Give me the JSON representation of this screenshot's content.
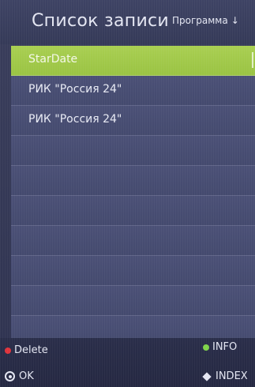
{
  "header": {
    "title": "Список записи",
    "sort_label": "Программа",
    "sort_arrow": "↓"
  },
  "recordings": [
    {
      "label": "StarDate",
      "selected": true
    },
    {
      "label": "РИК \"Россия 24\"",
      "selected": false
    },
    {
      "label": "РИК \"Россия 24\"",
      "selected": false
    },
    {
      "label": "",
      "selected": false
    },
    {
      "label": "",
      "selected": false
    },
    {
      "label": "",
      "selected": false
    },
    {
      "label": "",
      "selected": false
    },
    {
      "label": "",
      "selected": false
    },
    {
      "label": "",
      "selected": false
    },
    {
      "label": "",
      "selected": false
    }
  ],
  "footer": {
    "delete_label": "Delete",
    "info_label": "INFO",
    "ok_label": "OK",
    "index_label": "INDEX"
  },
  "colors": {
    "delete_dot": "#e0343c",
    "info_dot": "#7fd34a",
    "selected_row": "#a9cf52"
  },
  "icons": {
    "delete": "red-dot-icon",
    "info": "green-dot-icon",
    "ok": "ok-circle-icon",
    "index": "diamond-icon"
  }
}
